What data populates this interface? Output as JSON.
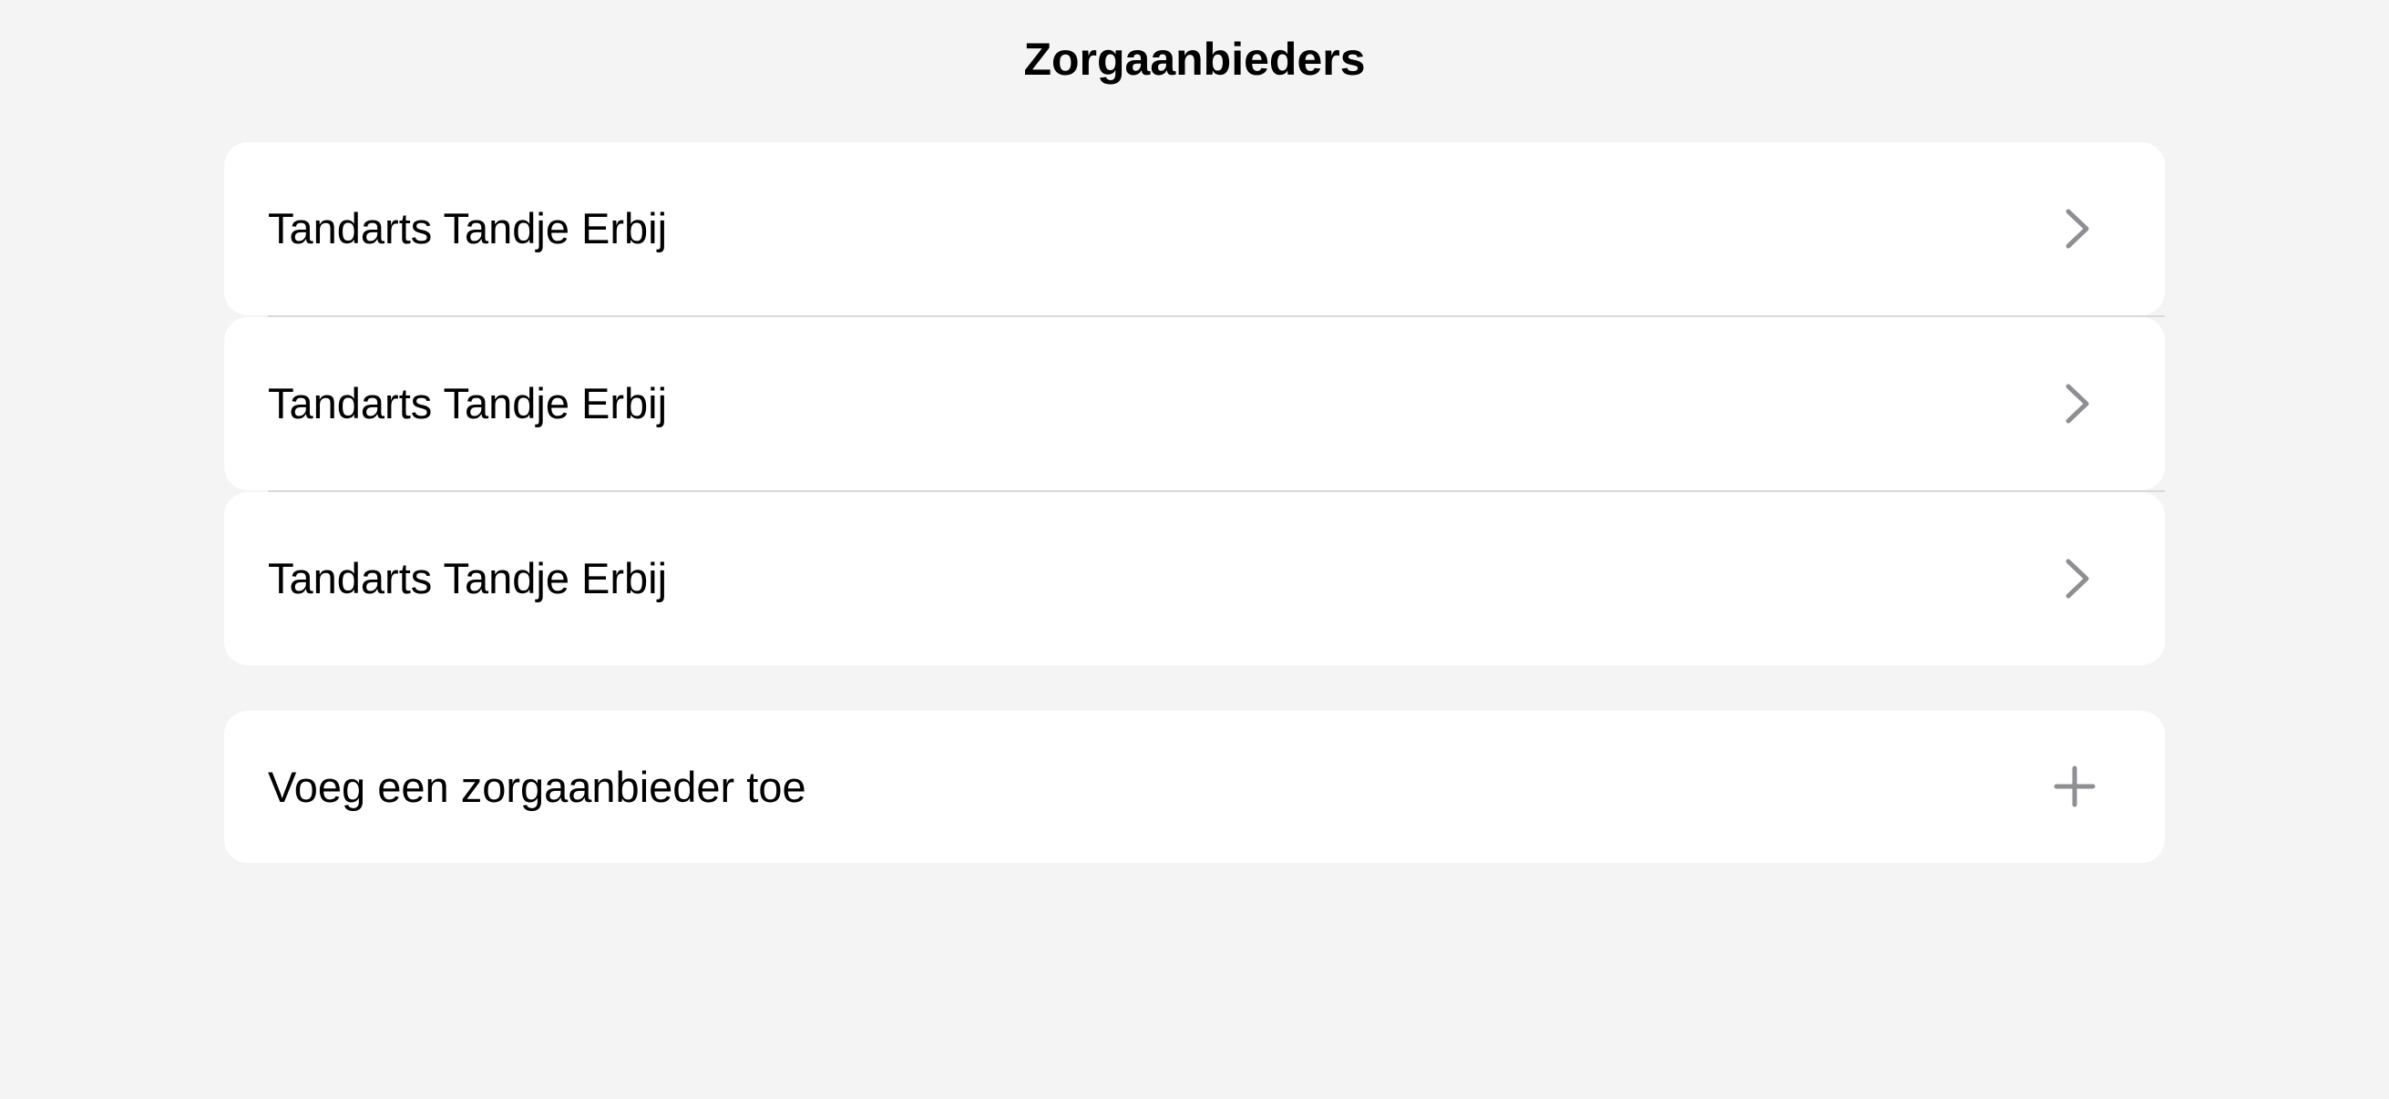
{
  "header": {
    "title": "Zorgaanbieders"
  },
  "providers": [
    {
      "name": "Tandarts Tandje Erbij",
      "icon": "chevron-right-icon"
    },
    {
      "name": "Tandarts Tandje Erbij",
      "icon": "chevron-right-icon"
    },
    {
      "name": "Tandarts Tandje Erbij",
      "icon": "chevron-right-icon"
    }
  ],
  "add_provider": {
    "label": "Voeg een zorgaanbieder toe",
    "icon": "plus-icon"
  },
  "colors": {
    "background": "#f4f4f4",
    "card": "#ffffff",
    "icon": "#8e8e93",
    "divider": "#d9d9d9"
  }
}
